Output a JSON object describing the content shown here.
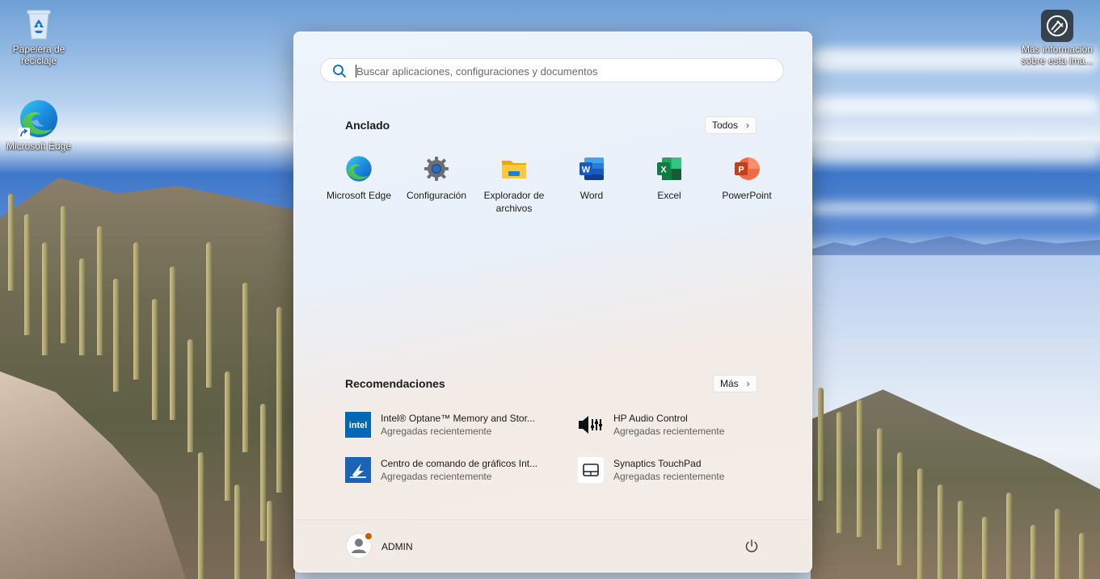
{
  "desktop": {
    "icons": [
      {
        "label": "Papelera de reciclaje",
        "icon": "recycle-bin-icon"
      },
      {
        "label": "Microsoft Edge",
        "icon": "edge-icon"
      },
      {
        "label": "Más información sobre esta ima...",
        "icon": "camera-info-icon"
      }
    ]
  },
  "start_menu": {
    "search": {
      "placeholder": "Buscar aplicaciones, configuraciones y documentos",
      "value": ""
    },
    "pinned": {
      "title": "Anclado",
      "all_button": "Todos",
      "apps": [
        {
          "label": "Microsoft Edge",
          "icon": "edge-icon"
        },
        {
          "label": "Configuración",
          "icon": "gear-icon"
        },
        {
          "label": "Explorador de archivos",
          "icon": "folder-icon"
        },
        {
          "label": "Word",
          "icon": "word-icon"
        },
        {
          "label": "Excel",
          "icon": "excel-icon"
        },
        {
          "label": "PowerPoint",
          "icon": "powerpoint-icon"
        }
      ]
    },
    "recommendations": {
      "title": "Recomendaciones",
      "more_button": "Más",
      "items": [
        {
          "name": "Intel® Optane™ Memory and Stor...",
          "sub": "Agregadas recientemente",
          "icon": "intel-icon"
        },
        {
          "name": "HP Audio Control",
          "sub": "Agregadas recientemente",
          "icon": "audio-control-icon"
        },
        {
          "name": "Centro de comando de gráficos Int...",
          "sub": "Agregadas recientemente",
          "icon": "graphics-command-icon"
        },
        {
          "name": "Synaptics TouchPad",
          "sub": "Agregadas recientemente",
          "icon": "touchpad-icon"
        }
      ]
    },
    "user": {
      "name": "ADMIN"
    },
    "colors": {
      "accent": "#0067c0",
      "edge_blue": "#1d8de0",
      "excel": "#107c41",
      "word": "#185abd",
      "powerpoint": "#c43e1c",
      "intel": "#0068b5"
    }
  }
}
